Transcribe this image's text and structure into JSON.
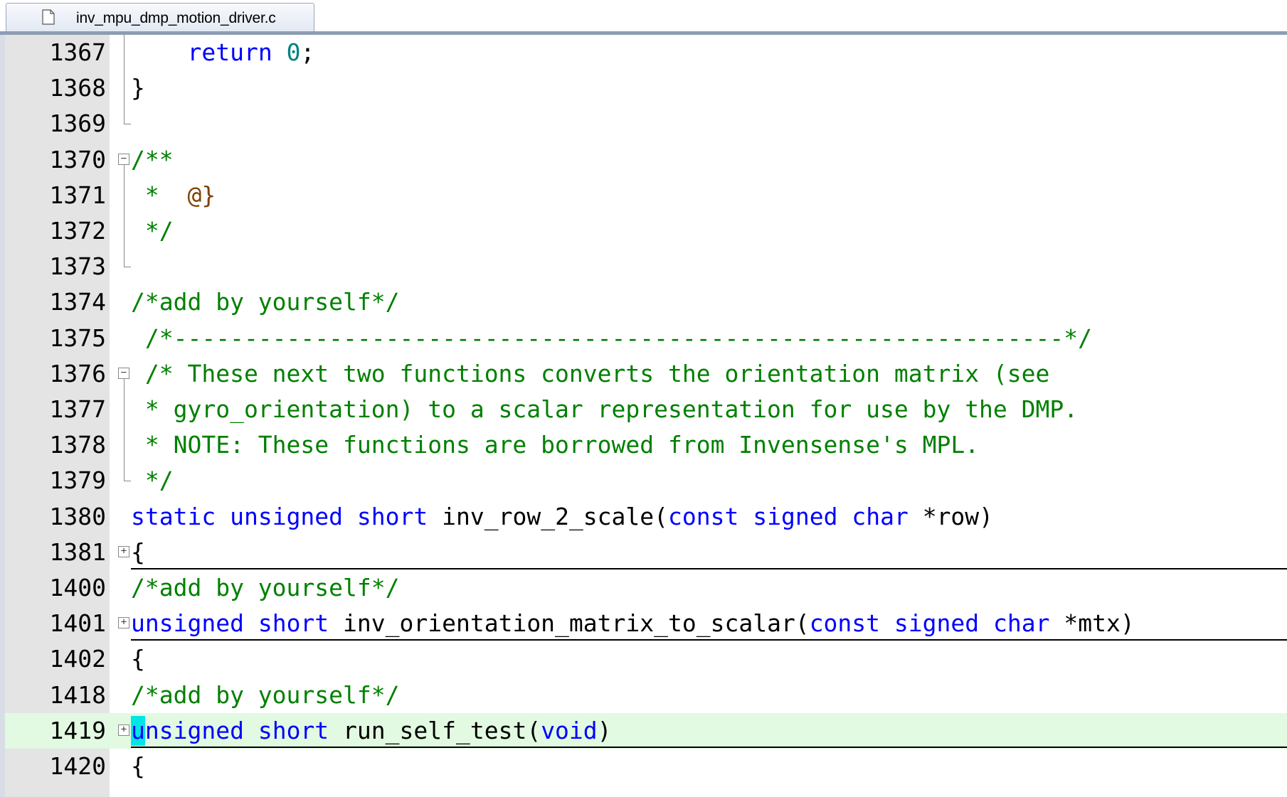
{
  "tab": {
    "filename": "inv_mpu_dmp_motion_driver.c",
    "icon": "file-icon"
  },
  "lines": [
    {
      "num": "1367",
      "tokens": [
        {
          "t": "    ",
          "c": "tx"
        },
        {
          "t": "return",
          "c": "kw"
        },
        {
          "t": " ",
          "c": "tx"
        },
        {
          "t": "0",
          "c": "num"
        },
        {
          "t": ";",
          "c": "tx"
        }
      ]
    },
    {
      "num": "1368",
      "tokens": [
        {
          "t": "}",
          "c": "tx"
        }
      ]
    },
    {
      "num": "1369",
      "tokens": []
    },
    {
      "num": "1370",
      "tokens": [
        {
          "t": "/**",
          "c": "cm"
        }
      ]
    },
    {
      "num": "1371",
      "tokens": [
        {
          "t": " *  ",
          "c": "cm"
        },
        {
          "t": "@}",
          "c": "doc"
        }
      ]
    },
    {
      "num": "1372",
      "tokens": [
        {
          "t": " */",
          "c": "cm"
        }
      ]
    },
    {
      "num": "1373",
      "tokens": []
    },
    {
      "num": "1374",
      "tokens": [
        {
          "t": "/*add by yourself*/",
          "c": "cm"
        }
      ]
    },
    {
      "num": "1375",
      "tokens": [
        {
          "t": " /*---------------------------------------------------------------*/",
          "c": "cm"
        }
      ]
    },
    {
      "num": "1376",
      "tokens": [
        {
          "t": " /* These next two functions converts the orientation matrix (see",
          "c": "cm"
        }
      ]
    },
    {
      "num": "1377",
      "tokens": [
        {
          "t": " * gyro_orientation) to a scalar representation for use by the DMP.",
          "c": "cm"
        }
      ]
    },
    {
      "num": "1378",
      "tokens": [
        {
          "t": " * NOTE: These functions are borrowed from Invensense's MPL.",
          "c": "cm"
        }
      ]
    },
    {
      "num": "1379",
      "tokens": [
        {
          "t": " */",
          "c": "cm"
        }
      ]
    },
    {
      "num": "1380",
      "tokens": [
        {
          "t": "static",
          "c": "kw"
        },
        {
          "t": " ",
          "c": "tx"
        },
        {
          "t": "unsigned",
          "c": "kw"
        },
        {
          "t": " ",
          "c": "tx"
        },
        {
          "t": "short",
          "c": "kw"
        },
        {
          "t": " inv_row_2_scale(",
          "c": "tx"
        },
        {
          "t": "const",
          "c": "kw"
        },
        {
          "t": " ",
          "c": "tx"
        },
        {
          "t": "signed",
          "c": "kw"
        },
        {
          "t": " ",
          "c": "tx"
        },
        {
          "t": "char",
          "c": "kw"
        },
        {
          "t": " *row)",
          "c": "tx"
        }
      ]
    },
    {
      "num": "1381",
      "tokens": [
        {
          "t": "{",
          "c": "tx"
        }
      ]
    },
    {
      "num": "1400",
      "tokens": [
        {
          "t": "/*add by yourself*/",
          "c": "cm"
        }
      ]
    },
    {
      "num": "1401",
      "tokens": [
        {
          "t": "unsigned",
          "c": "kw"
        },
        {
          "t": " ",
          "c": "tx"
        },
        {
          "t": "short",
          "c": "kw"
        },
        {
          "t": " inv_orientation_matrix_to_scalar(",
          "c": "tx"
        },
        {
          "t": "const",
          "c": "kw"
        },
        {
          "t": " ",
          "c": "tx"
        },
        {
          "t": "signed",
          "c": "kw"
        },
        {
          "t": " ",
          "c": "tx"
        },
        {
          "t": "char",
          "c": "kw"
        },
        {
          "t": " *mtx)",
          "c": "tx"
        }
      ]
    },
    {
      "num": "1402",
      "tokens": [
        {
          "t": "{",
          "c": "tx"
        }
      ]
    },
    {
      "num": "1418",
      "tokens": [
        {
          "t": "/*add by yourself*/",
          "c": "cm"
        }
      ]
    },
    {
      "num": "1419",
      "tokens": [
        {
          "t": "unsigned",
          "c": "kw"
        },
        {
          "t": " ",
          "c": "tx"
        },
        {
          "t": "short",
          "c": "kw"
        },
        {
          "t": " run_self_test(",
          "c": "tx"
        },
        {
          "t": "void",
          "c": "kw"
        },
        {
          "t": ")",
          "c": "tx"
        }
      ]
    },
    {
      "num": "1420",
      "tokens": [
        {
          "t": "{",
          "c": "tx"
        }
      ]
    }
  ]
}
